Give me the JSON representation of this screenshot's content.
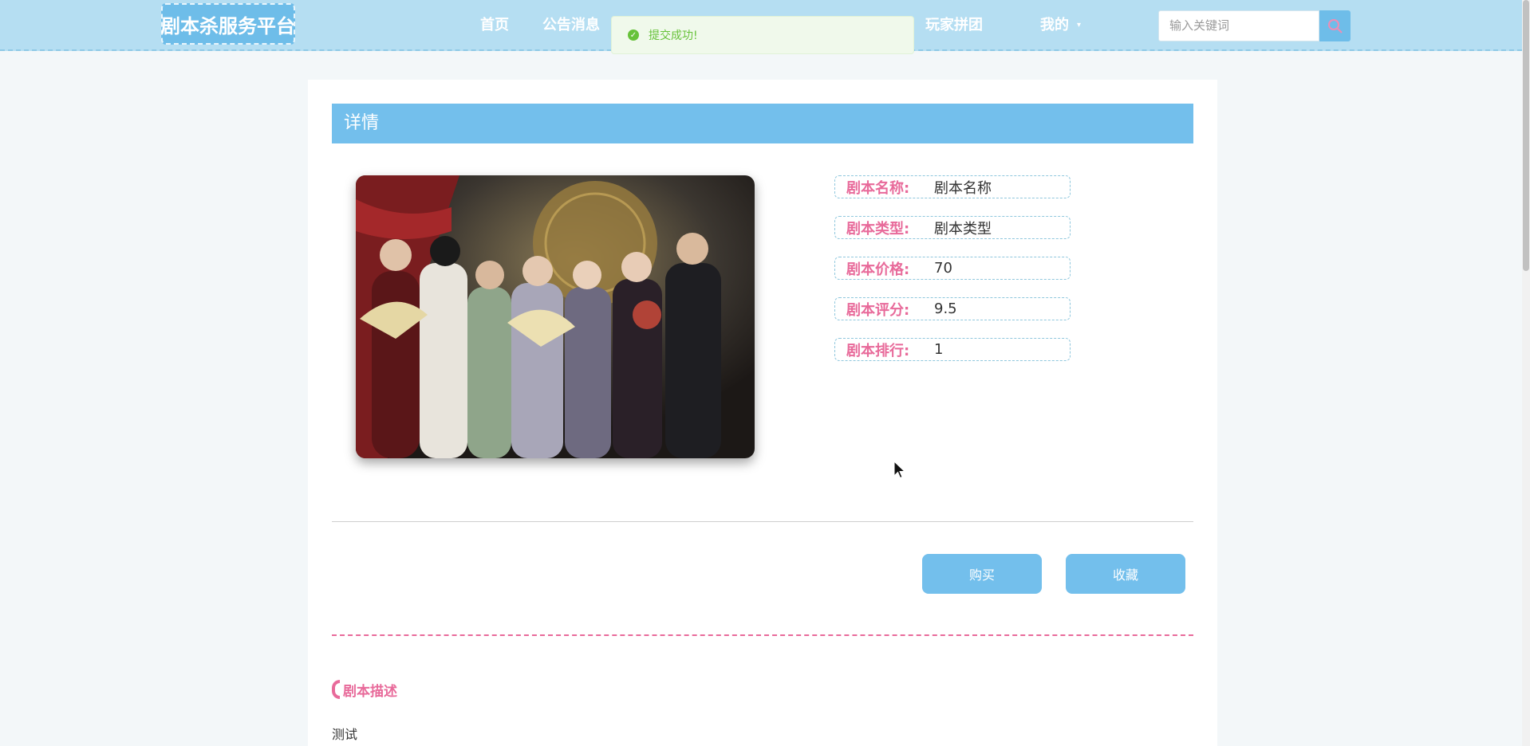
{
  "header": {
    "logo": "剧本杀服务平台",
    "nav": [
      {
        "label": "首页"
      },
      {
        "label": "公告消息"
      },
      {
        "label": "玩家拼团"
      },
      {
        "label": "我的"
      }
    ],
    "search": {
      "placeholder": "输入关键词"
    }
  },
  "toast": {
    "message": "提交成功!"
  },
  "detail": {
    "section_title": "详情",
    "fields": [
      {
        "label": "剧本名称:",
        "value": "剧本名称"
      },
      {
        "label": "剧本类型:",
        "value": "剧本类型"
      },
      {
        "label": "剧本价格:",
        "value": "70"
      },
      {
        "label": "剧本评分:",
        "value": "9.5"
      },
      {
        "label": "剧本排行:",
        "value": "1"
      }
    ],
    "buttons": {
      "buy": "购买",
      "favorite": "收藏"
    },
    "description": {
      "title": "剧本描述",
      "text": "测试"
    }
  },
  "colors": {
    "nav_bg": "#b5def2",
    "accent_blue": "#73bfec",
    "accent_pink": "#e86a9a",
    "toast_green": "#67c23a"
  }
}
